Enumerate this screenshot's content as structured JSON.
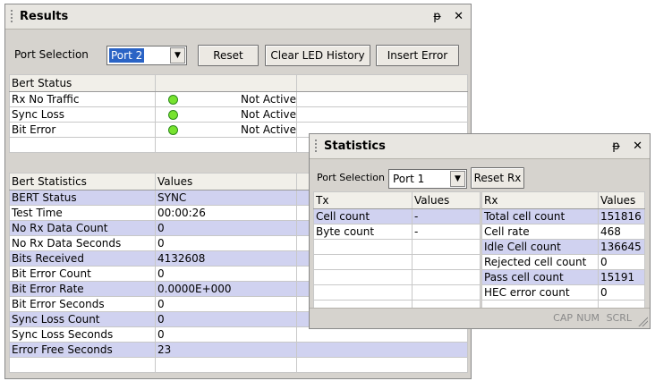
{
  "results": {
    "title": "Results",
    "pin": "ᵽ",
    "close": "✕",
    "port_selection_label": "Port Selection",
    "port_value": "Port 2",
    "reset_label": "Reset",
    "clear_led_label": "Clear LED History",
    "insert_error_label": "Insert Error",
    "bert_status": {
      "header": "Bert Status",
      "rows": [
        {
          "name": "Rx No Traffic",
          "status": "Not Active"
        },
        {
          "name": "Sync Loss",
          "status": "Not Active"
        },
        {
          "name": "Bit Error",
          "status": "Not Active"
        }
      ],
      "led_color": "#77e32f"
    },
    "bert_statistics": {
      "headers": [
        "Bert Statistics",
        "Values"
      ],
      "rows": [
        {
          "name": "BERT Status",
          "value": "SYNC"
        },
        {
          "name": "Test Time",
          "value": "00:00:26"
        },
        {
          "name": "No Rx Data Count",
          "value": "0"
        },
        {
          "name": "No Rx Data Seconds",
          "value": "0"
        },
        {
          "name": "Bits Received",
          "value": "4132608"
        },
        {
          "name": "Bit Error Count",
          "value": "0"
        },
        {
          "name": "Bit Error Rate",
          "value": "0.0000E+000"
        },
        {
          "name": "Bit Error Seconds",
          "value": "0"
        },
        {
          "name": "Sync Loss Count",
          "value": "0"
        },
        {
          "name": "Sync Loss Seconds",
          "value": "0"
        },
        {
          "name": "Error Free Seconds",
          "value": "23"
        }
      ]
    }
  },
  "statistics": {
    "title": "Statistics",
    "pin": "ᵽ",
    "close": "✕",
    "port_selection_label": "Port Selection",
    "port_value": "Port 1",
    "reset_rx_label": "Reset Rx",
    "tx": {
      "headers": [
        "Tx",
        "Values"
      ],
      "rows": [
        {
          "name": "Cell count",
          "value": "-"
        },
        {
          "name": "Byte count",
          "value": "-"
        }
      ]
    },
    "rx": {
      "headers": [
        "Rx",
        "Values"
      ],
      "rows": [
        {
          "name": "Total cell count",
          "value": "151816"
        },
        {
          "name": "Cell rate",
          "value": "468"
        },
        {
          "name": "Idle Cell count",
          "value": "136645"
        },
        {
          "name": "Rejected cell count",
          "value": "0"
        },
        {
          "name": "Pass cell count",
          "value": "15191"
        },
        {
          "name": "HEC error count",
          "value": "0"
        }
      ]
    },
    "statusbar": {
      "cap": "CAP",
      "num": "NUM",
      "scrl": "SCRL"
    }
  },
  "colors": {
    "highlight_row": "#d0d2f0",
    "selection": "#2a63c5"
  }
}
